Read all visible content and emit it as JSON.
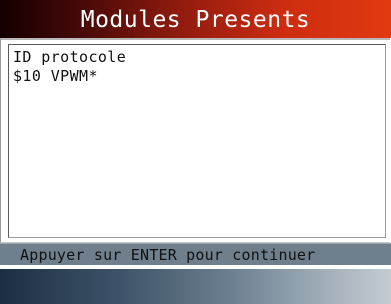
{
  "header": {
    "title": "Modules Presents"
  },
  "content": {
    "lines": [
      "ID protocole",
      "$10 VPWM*"
    ]
  },
  "status_bar": {
    "message": "Appuyer sur ENTER pour continuer"
  },
  "colors": {
    "title_gradient_start": "#140000",
    "title_gradient_end": "#e23a10",
    "status_bar": "#6f7f8c",
    "bottom_gradient_start": "#1c2e44",
    "bottom_gradient_end": "#c4ccd2"
  }
}
